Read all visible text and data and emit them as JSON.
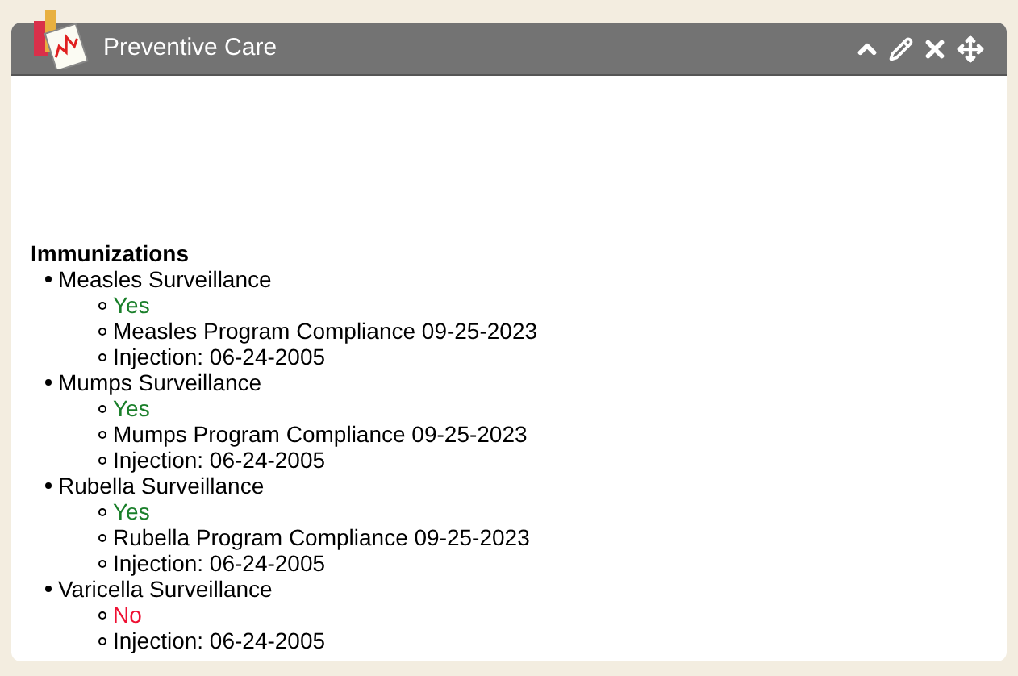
{
  "panel": {
    "title": "Preventive Care"
  },
  "section": {
    "heading": "Immunizations",
    "items": [
      {
        "label": "Measles Surveillance",
        "children": [
          {
            "kind": "result",
            "positive": true,
            "text": "Yes"
          },
          {
            "kind": "text",
            "text": "Measles Program Compliance 09-25-2023"
          },
          {
            "kind": "text",
            "text": "Injection: 06-24-2005"
          }
        ]
      },
      {
        "label": "Mumps Surveillance",
        "children": [
          {
            "kind": "result",
            "positive": true,
            "text": "Yes"
          },
          {
            "kind": "text",
            "text": "Mumps Program Compliance 09-25-2023"
          },
          {
            "kind": "text",
            "text": "Injection: 06-24-2005"
          }
        ]
      },
      {
        "label": "Rubella Surveillance",
        "children": [
          {
            "kind": "result",
            "positive": true,
            "text": "Yes"
          },
          {
            "kind": "text",
            "text": "Rubella Program Compliance 09-25-2023"
          },
          {
            "kind": "text",
            "text": "Injection: 06-24-2005"
          }
        ]
      },
      {
        "label": "Varicella Surveillance",
        "children": [
          {
            "kind": "result",
            "positive": false,
            "text": "No"
          },
          {
            "kind": "text",
            "text": "Injection: 06-24-2005"
          }
        ]
      }
    ]
  }
}
